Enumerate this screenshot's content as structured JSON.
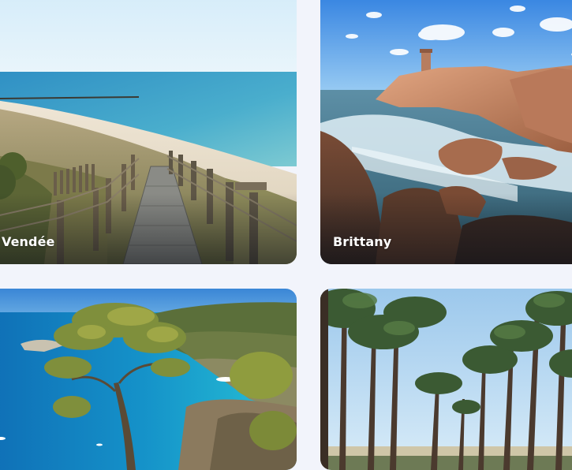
{
  "destinations": [
    {
      "name": "Vendée"
    },
    {
      "name": "Brittany"
    },
    {
      "name": ""
    },
    {
      "name": ""
    }
  ]
}
